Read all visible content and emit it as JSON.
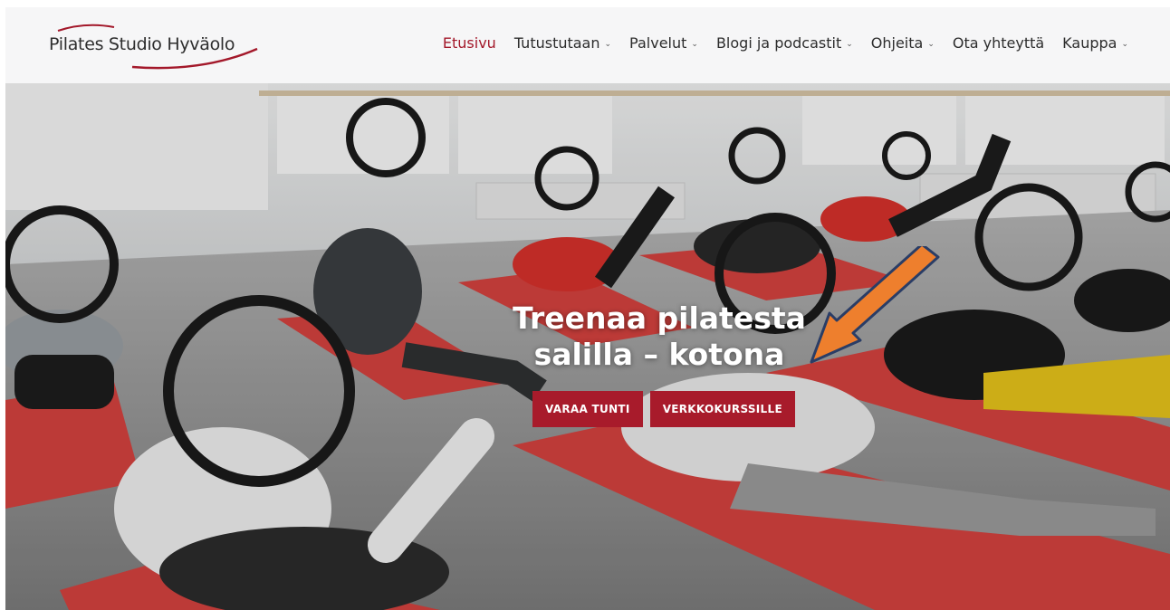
{
  "logo": {
    "text": "Pilates Studio Hyväolo"
  },
  "nav": {
    "items": [
      {
        "label": "Etusivu",
        "active": true,
        "dropdown": false
      },
      {
        "label": "Tutustutaan",
        "active": false,
        "dropdown": true
      },
      {
        "label": "Palvelut",
        "active": false,
        "dropdown": true
      },
      {
        "label": "Blogi ja podcastit",
        "active": false,
        "dropdown": true
      },
      {
        "label": "Ohjeita",
        "active": false,
        "dropdown": true
      },
      {
        "label": "Ota yhteyttä",
        "active": false,
        "dropdown": false
      },
      {
        "label": "Kauppa",
        "active": false,
        "dropdown": true
      }
    ],
    "chevron": "⌄"
  },
  "hero": {
    "title_line1": "Treenaa pilatesta",
    "title_line2": "salilla – kotona",
    "button_book": "VARAA TUNTI",
    "button_courses": "VERKKOKURSSILLE"
  },
  "colors": {
    "accent": "#a3182a",
    "button": "#a81b2b",
    "arrow": "#ee7f2d",
    "mat": "#d9403f"
  }
}
